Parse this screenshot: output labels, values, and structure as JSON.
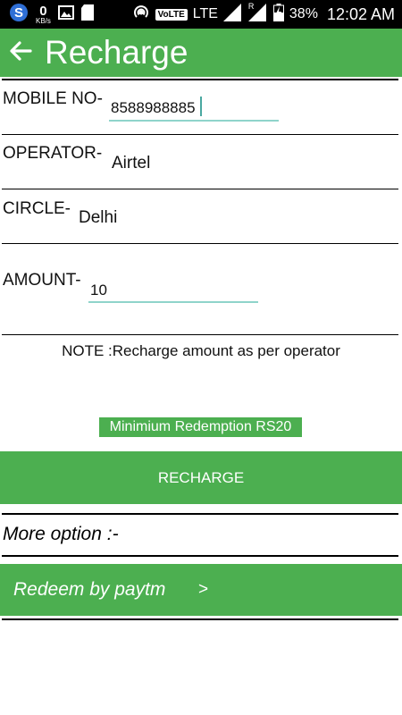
{
  "status_bar": {
    "speed_value": "0",
    "speed_unit": "KB/s",
    "volte": "VoLTE",
    "network": "LTE",
    "roaming": "R",
    "battery": "38%",
    "time": "12:02 AM"
  },
  "app_bar": {
    "title": "Recharge"
  },
  "form": {
    "mobile_label": "MOBILE NO-",
    "mobile_value": "8588988885",
    "operator_label": "OPERATOR-",
    "operator_value": "Airtel",
    "circle_label": "CIRCLE-",
    "circle_value": "Delhi",
    "amount_label": "AMOUNT-",
    "amount_value": "10"
  },
  "note": "NOTE :Recharge amount as per operator",
  "min_redemption": "Minimium Redemption RS20",
  "recharge_button": "RECHARGE",
  "more_option": "More option :-",
  "redeem": {
    "label": "Redeem by paytm",
    "arrow": ">"
  },
  "colors": {
    "accent": "#4caf50",
    "underline": "#8fd4cb"
  }
}
